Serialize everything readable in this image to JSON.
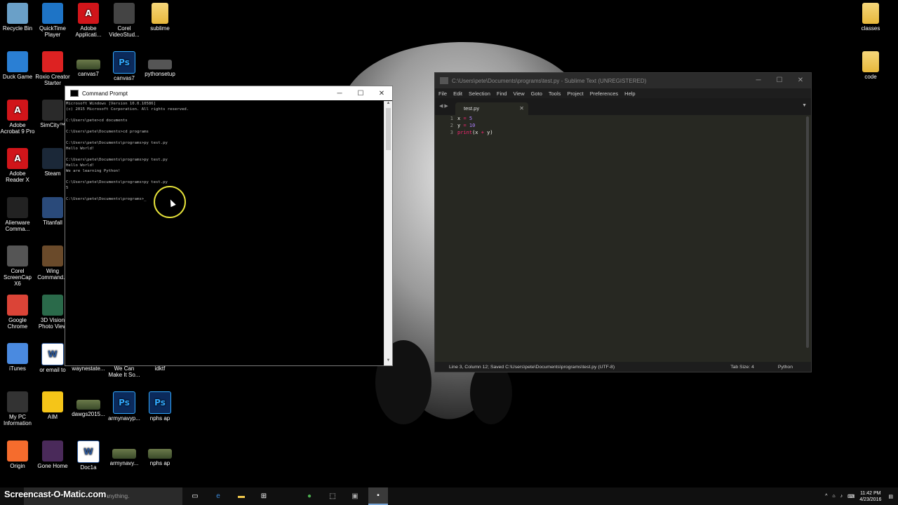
{
  "desktop": {
    "icons_left": [
      {
        "label": "Recycle Bin",
        "icon": "recycle-bin-icon"
      },
      {
        "label": "QuickTime\nPlayer",
        "icon": "quicktime-icon"
      },
      {
        "label": "Adobe\nApplicati...",
        "icon": "adobe-icon"
      },
      {
        "label": "Corel\nVideoStud...",
        "icon": "corel-videostudio-icon"
      },
      {
        "label": "sublime",
        "icon": "folder-icon"
      },
      {
        "label": "Duck Game",
        "icon": "duck-game-icon"
      },
      {
        "label": "Roxio Creator\nStarter",
        "icon": "roxio-icon"
      },
      {
        "label": "canvas7",
        "icon": "image-thumbnail-icon"
      },
      {
        "label": "canvas7",
        "icon": "psd-file-icon"
      },
      {
        "label": "pythonsetup",
        "icon": "installer-icon"
      },
      {
        "label": "Adobe\nAcrobat 9 Pro",
        "icon": "acrobat-icon"
      },
      {
        "label": "SimCity™",
        "icon": "simcity-icon"
      },
      {
        "label": "Adobe\nReader X",
        "icon": "adobe-reader-icon"
      },
      {
        "label": "Steam",
        "icon": "steam-icon"
      },
      {
        "label": "Alienware\nComma...",
        "icon": "alienware-icon"
      },
      {
        "label": "Titanfall",
        "icon": "titanfall-icon"
      },
      {
        "label": "Corel\nScreenCap X6",
        "icon": "corel-screencap-icon"
      },
      {
        "label": "Wing\nCommand...",
        "icon": "wing-commander-icon"
      },
      {
        "label": "Google\nChrome",
        "icon": "chrome-icon"
      },
      {
        "label": "3D Vision\nPhoto View",
        "icon": "3d-vision-icon"
      },
      {
        "label": "iTunes",
        "icon": "itunes-icon"
      },
      {
        "label": "or email to",
        "icon": "word-doc-icon"
      },
      {
        "label": "waynestate...",
        "icon": "file-icon"
      },
      {
        "label": "We Can\nMake It So...",
        "icon": "file-icon"
      },
      {
        "label": "idktf",
        "icon": "file-icon"
      },
      {
        "label": "My PC\nInformation",
        "icon": "alien-icon"
      },
      {
        "label": "AIM",
        "icon": "aim-icon"
      },
      {
        "label": "dawgs2015...",
        "icon": "image-thumbnail-icon"
      },
      {
        "label": "armynavyp...",
        "icon": "psd-file-icon"
      },
      {
        "label": "nphs ap",
        "icon": "psd-file-icon"
      },
      {
        "label": "Origin",
        "icon": "origin-icon"
      },
      {
        "label": "Gone Home",
        "icon": "gone-home-icon"
      },
      {
        "label": "Doc1a",
        "icon": "word-doc-icon"
      },
      {
        "label": "armynavy...",
        "icon": "image-thumbnail-icon"
      },
      {
        "label": "nphs ap",
        "icon": "image-thumbnail-icon"
      }
    ],
    "icons_right": [
      {
        "label": "classes",
        "icon": "folder-icon"
      },
      {
        "label": "code",
        "icon": "folder-icon"
      }
    ]
  },
  "cmd_window": {
    "title": "Command Prompt",
    "lines": [
      "Microsoft Windows [Version 10.0.10586]",
      "(c) 2015 Microsoft Corporation. All rights reserved.",
      "",
      "C:\\Users\\pete>cd documents",
      "",
      "C:\\Users\\pete\\Documents>cd programs",
      "",
      "C:\\Users\\pete\\Documents\\programs>py test.py",
      "Hello World!",
      "",
      "C:\\Users\\pete\\Documents\\programs>py test.py",
      "Hello World!",
      "We are learning Python!",
      "",
      "C:\\Users\\pete\\Documents\\programs>py test.py",
      "5",
      "",
      "C:\\Users\\pete\\Documents\\programs>_"
    ]
  },
  "sublime_window": {
    "title": "C:\\Users\\pete\\Documents\\programs\\test.py - Sublime Text (UNREGISTERED)",
    "menu": [
      "File",
      "Edit",
      "Selection",
      "Find",
      "View",
      "Goto",
      "Tools",
      "Project",
      "Preferences",
      "Help"
    ],
    "tab": "test.py",
    "line_numbers": [
      "1",
      "2",
      "3"
    ],
    "status_left": "Line 3, Column 12; Saved C:\\Users\\pete\\Documents\\programs\\test.py (UTF-8)",
    "tab_size": "Tab Size: 4",
    "syntax": "Python"
  },
  "taskbar": {
    "watermark": "Screencast-O-Matic.com",
    "search_placeholder": "anything.",
    "clock_time": "11:42 PM",
    "clock_date": "4/23/2016"
  },
  "colors": {
    "sublime_bg": "#272822",
    "keyword": "#f92672",
    "number": "#ae81ff",
    "function": "#66d9ef",
    "cursor_ring": "#e6e23a"
  }
}
